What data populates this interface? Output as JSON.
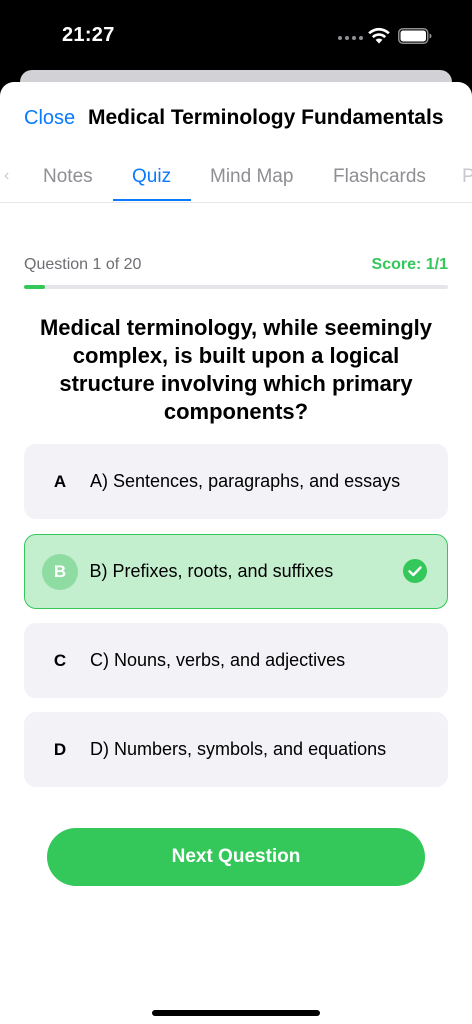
{
  "status": {
    "time": "21:27"
  },
  "header": {
    "close_label": "Close",
    "title": "Medical Terminology Fundamentals"
  },
  "tabs": [
    {
      "label": "Notes",
      "active": false
    },
    {
      "label": "Quiz",
      "active": true
    },
    {
      "label": "Mind Map",
      "active": false
    },
    {
      "label": "Flashcards",
      "active": false
    }
  ],
  "quiz": {
    "counter": "Question 1 of 20",
    "score": "Score: 1/1",
    "progress_fraction": 0.05,
    "question": "Medical terminology, while seemingly complex, is built upon a logical structure involving which primary components?",
    "options": [
      {
        "letter": "A",
        "text": "A) Sentences, paragraphs, and essays",
        "state": "default"
      },
      {
        "letter": "B",
        "text": "B) Prefixes, roots, and suffixes",
        "state": "correct"
      },
      {
        "letter": "C",
        "text": "C) Nouns, verbs, and adjectives",
        "state": "default"
      },
      {
        "letter": "D",
        "text": "D) Numbers, symbols, and equations",
        "state": "default"
      }
    ],
    "next_label": "Next Question"
  },
  "colors": {
    "accent": "#0a7aff",
    "success": "#34c759",
    "correct_bg": "#c4efcf"
  }
}
